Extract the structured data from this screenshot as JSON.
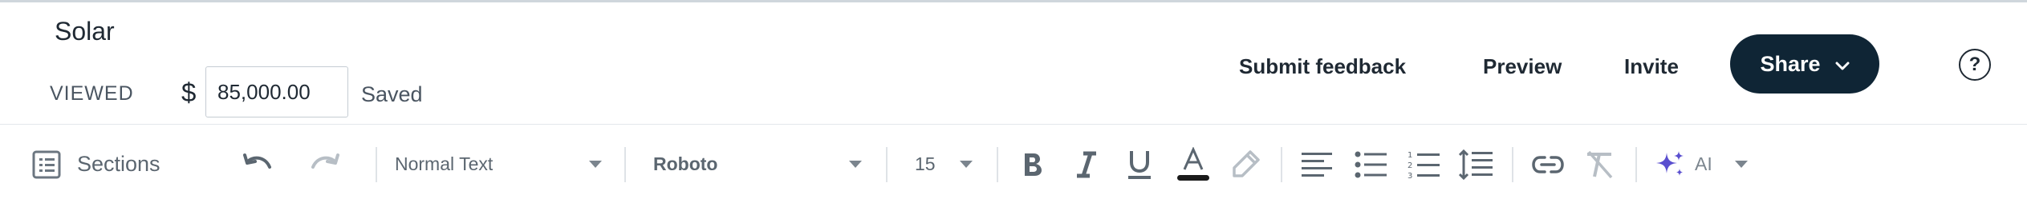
{
  "document": {
    "title": "Solar",
    "status": "VIEWED",
    "currency_symbol": "$",
    "amount": "85,000.00",
    "save_state": "Saved"
  },
  "header": {
    "submit_feedback_label": "Submit feedback",
    "preview_label": "Preview",
    "invite_label": "Invite",
    "share_label": "Share",
    "help_label": "?"
  },
  "toolbar": {
    "sections_label": "Sections",
    "text_style": "Normal Text",
    "font_family": "Roboto",
    "font_size": "15",
    "ai_label": "AI"
  },
  "colors": {
    "share_bg": "#0f2535",
    "text_color_underline": "#1a1a1a",
    "ai_accent": "#5a4fcf"
  },
  "icons": [
    "sections-icon",
    "undo-icon",
    "redo-icon",
    "bold-icon",
    "italic-icon",
    "underline-icon",
    "text-color-icon",
    "highlight-icon",
    "align-left-icon",
    "bullet-list-icon",
    "numbered-list-icon",
    "line-spacing-icon",
    "link-icon",
    "clear-format-icon",
    "ai-sparkle-icon",
    "chevron-down-icon",
    "help-icon"
  ]
}
